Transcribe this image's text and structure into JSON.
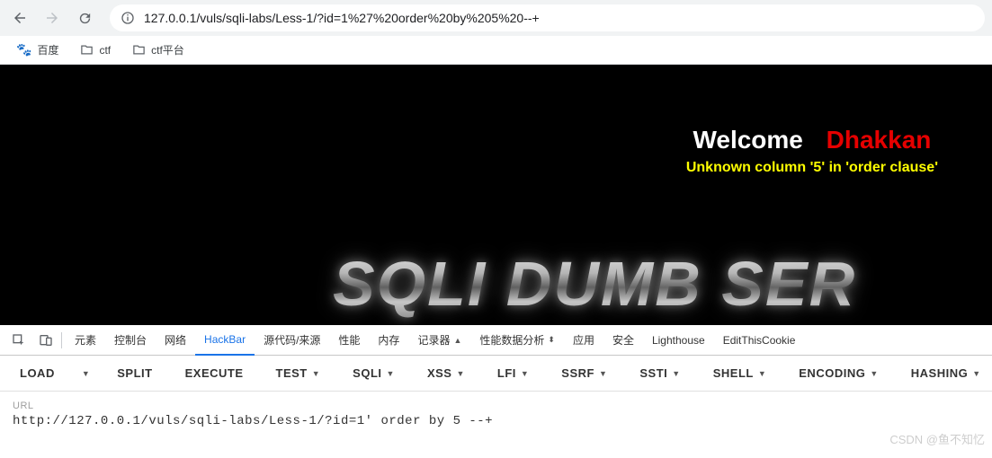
{
  "browser": {
    "url": "127.0.0.1/vuls/sqli-labs/Less-1/?id=1%27%20order%20by%205%20--+"
  },
  "bookmarks": [
    {
      "label": "百度",
      "icon": "paw"
    },
    {
      "label": "ctf",
      "icon": "folder"
    },
    {
      "label": "ctf平台",
      "icon": "folder"
    }
  ],
  "page": {
    "welcome": "Welcome",
    "username": "Dhakkan",
    "error": "Unknown column '5' in 'order clause'",
    "big_title": "SQLI DUMB SER"
  },
  "devtools": {
    "tabs": [
      "元素",
      "控制台",
      "网络",
      "HackBar",
      "源代码/来源",
      "性能",
      "内存",
      "记录器",
      "性能数据分析",
      "应用",
      "安全",
      "Lighthouse",
      "EditThisCookie"
    ],
    "active": "HackBar",
    "recorder_suffix": "▲",
    "perf_suffix": "⬍"
  },
  "hackbar": {
    "actions": [
      {
        "label": "LOAD",
        "dropdown": true,
        "split": true
      },
      {
        "label": "SPLIT",
        "dropdown": false
      },
      {
        "label": "EXECUTE",
        "dropdown": false
      },
      {
        "label": "TEST",
        "dropdown": true
      },
      {
        "label": "SQLI",
        "dropdown": true
      },
      {
        "label": "XSS",
        "dropdown": true
      },
      {
        "label": "LFI",
        "dropdown": true
      },
      {
        "label": "SSRF",
        "dropdown": true
      },
      {
        "label": "SSTI",
        "dropdown": true
      },
      {
        "label": "SHELL",
        "dropdown": true
      },
      {
        "label": "ENCODING",
        "dropdown": true
      },
      {
        "label": "HASHING",
        "dropdown": true
      }
    ],
    "url_label": "URL",
    "url_value": "http://127.0.0.1/vuls/sqli-labs/Less-1/?id=1' order by 5 --+"
  },
  "watermark": "CSDN @鱼不知忆"
}
